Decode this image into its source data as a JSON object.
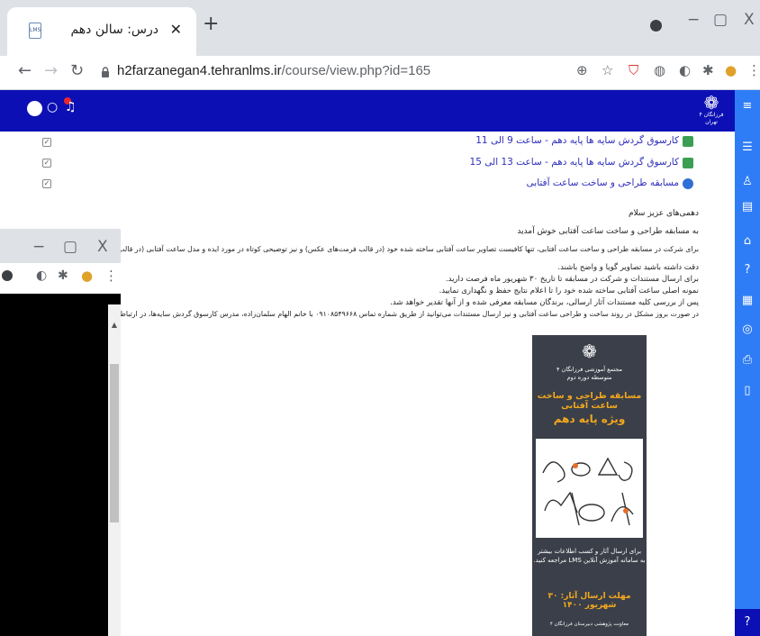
{
  "browser": {
    "tab_title": "درس: سالن دهم",
    "tab_favicon_text": "LMS",
    "url_host": "h2farzanegan4.tehranlms.ir",
    "url_path": "/course/view.php?id=165",
    "new_tab": "+",
    "minimize": "−",
    "maximize": "▢",
    "close": "X",
    "tab_close": "✕"
  },
  "site": {
    "logo_caption": "فرزانگان ۴ تهران",
    "notification_count": "1"
  },
  "activities": [
    {
      "title": "کارسوق گردش سایه ها پایه دهم - ساعت 9 الی 11",
      "type": "page"
    },
    {
      "title": "کارسوق گردش سایه ها پایه دهم - ساعت 13 الی 15",
      "type": "page"
    },
    {
      "title": "مسابقه طراحی و ساخت ساعت آفتابی",
      "type": "quiz"
    }
  ],
  "intro": {
    "greeting": "دهمی‌های عزیز سلام",
    "welcome": "به مسابقه طراحی و ساخت ساعت آفتابی خوش آمدید",
    "instruction": "برای شرکت در مسابقه طراحی و ساخت ساعت آفتابی، تنها کافیست تصاویر ساعت آفتابی ساخته شده خود (در قالب فرمت‌های عکس) و نیز توضیحی کوتاه در مورد ایده و مدل ساعت آفتابی (در قالب یک فایل pdf) را در همین بخش بارگذاری کنید."
  },
  "bullets": [
    "دقت داشته باشید تصاویر گویا و واضح باشند.",
    "برای ارسال مستندات و شرکت در مسابقه تا تاریخ ۳۰ شهریور ماه فرصت دارید.",
    "نمونه اصلی ساعت آفتابی ساخته شده خود را تا اعلام نتایج حفظ و نگهداری نمایید.",
    "پس از بررسی کلیه مستندات آثار ارسالی، برندگان مسابقه معرفی شده و از آنها تقدیر خواهد شد.",
    "در صورت بروز مشکل در روند ساخت و طراحی ساعت آفتابی و نیز ارسال مستندات می‌توانید از طریق شماره تماس ۰۹۱۰۸۵۴۹۶۶۸ با خانم الهام سلمان‌زاده، مدرس کارسوق گردش سایه‌ها، در ارتباط باشید."
  ],
  "poster": {
    "school": "مجتمع آموزشی فرزانگان ۴\nمتوسطه دوره دوم",
    "title_line1": "مسابقه طراحی و ساخت ساعت آفتابی",
    "title_line2": "ویژه پایه دهم",
    "info": "برای ارسال آثار و کسب اطلاعات بیشتر\nبه سامانه آموزش آنلاین LMS مراجعه کنید.",
    "deadline": "مهلت ارسال آثار: ۳۰ شهریور ۱۴۰۰",
    "footer": "معاونت پژوهشی دبیرستان فرزانگان ۴"
  },
  "colors": {
    "header_bg": "#0c10b4",
    "drawer_bg": "#2f7df6",
    "poster_bg": "#3a3f49",
    "poster_accent": "#f3a81d",
    "link": "#2d2dbb"
  }
}
